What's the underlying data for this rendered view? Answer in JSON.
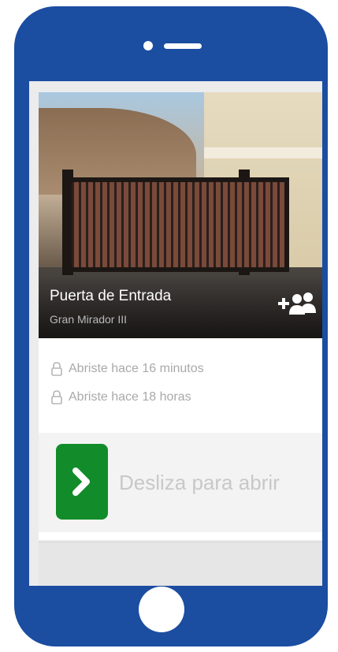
{
  "door": {
    "title": "Puerta de Entrada",
    "subtitle": "Gran Mirador III"
  },
  "activity": [
    {
      "text": "Abriste hace 16 minutos",
      "icon": "lock-icon"
    },
    {
      "text": "Abriste hace 18 horas",
      "icon": "lock-icon"
    }
  ],
  "slider": {
    "label": "Desliza para abrir",
    "icon": "chevron-right-icon",
    "accent": "#128c2a"
  },
  "share": {
    "icon": "add-users-icon"
  },
  "colors": {
    "phone_body": "#1b4da1",
    "accent": "#128c2a"
  }
}
